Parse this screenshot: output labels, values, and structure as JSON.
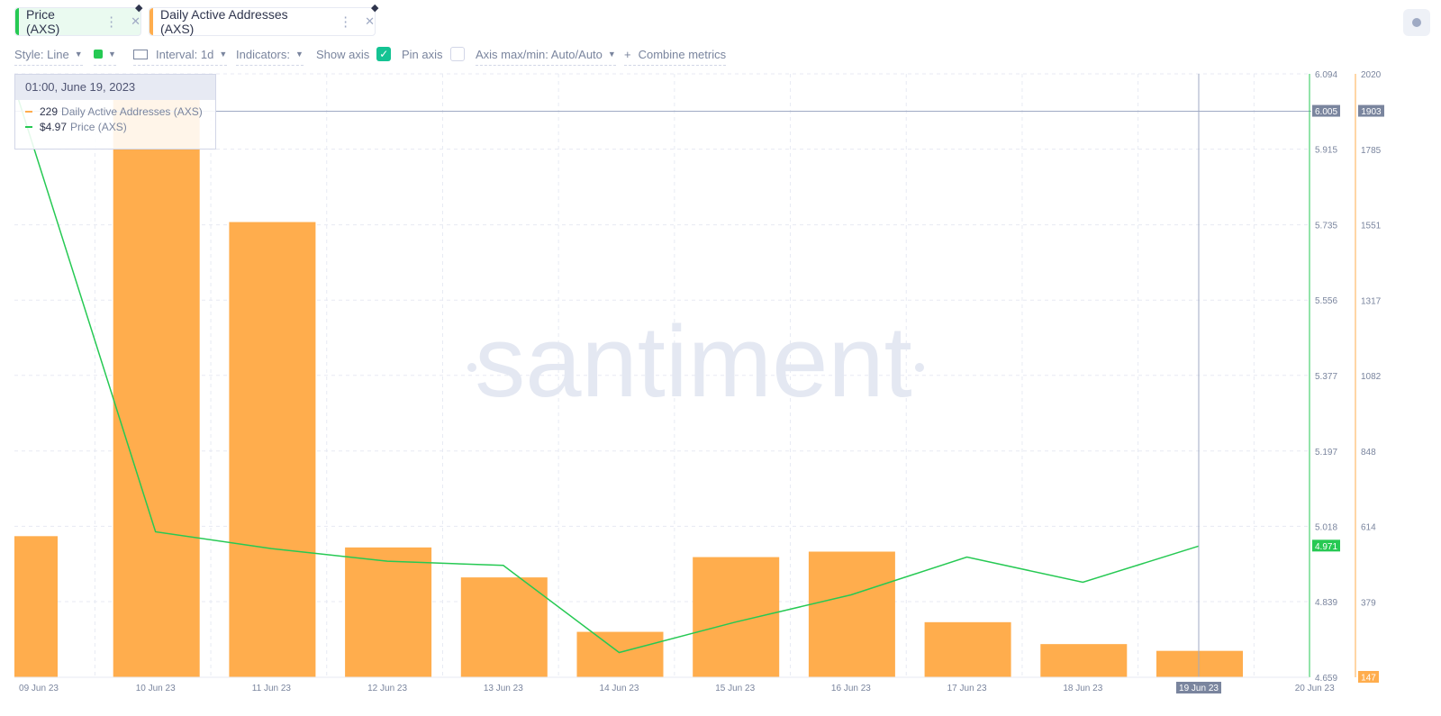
{
  "tabs": [
    {
      "label": "Price (AXS)",
      "color": "#26c953",
      "active": true
    },
    {
      "label": "Daily Active Addresses (AXS)",
      "color": "#ffad4d",
      "active": false
    }
  ],
  "toolbar": {
    "style_label": "Style: Line",
    "interval_label": "Interval: 1d",
    "indicators_label": "Indicators:",
    "show_axis_label": "Show axis",
    "show_axis_checked": true,
    "pin_axis_label": "Pin axis",
    "pin_axis_checked": false,
    "axis_maxmin_label": "Axis max/min: Auto/Auto",
    "combine_label": "Combine metrics",
    "metric_color": "#26c953"
  },
  "tooltip": {
    "date": "01:00, June 19, 2023",
    "rows": [
      {
        "value": "229",
        "name": "Daily Active Addresses (AXS)",
        "color": "#ffad4d"
      },
      {
        "value": "$4.97",
        "name": "Price (AXS)",
        "color": "#26c953"
      }
    ]
  },
  "watermark": "santiment",
  "chart_data": {
    "type": "bar",
    "categories": [
      "09 Jun 23",
      "10 Jun 23",
      "11 Jun 23",
      "12 Jun 23",
      "13 Jun 23",
      "14 Jun 23",
      "15 Jun 23",
      "16 Jun 23",
      "17 Jun 23",
      "18 Jun 23",
      "19 Jun 23",
      "20 Jun 23"
    ],
    "series": [
      {
        "name": "Daily Active Addresses (AXS)",
        "type": "bar",
        "color": "#ffad4d",
        "axis": "right",
        "values": [
          585,
          2020,
          1560,
          550,
          457,
          288,
          520,
          537,
          318,
          250,
          229,
          null
        ]
      },
      {
        "name": "Price (AXS)",
        "type": "line",
        "color": "#26c953",
        "axis": "left",
        "values": [
          6.05,
          5.005,
          4.965,
          4.935,
          4.925,
          4.718,
          4.79,
          4.855,
          4.945,
          4.885,
          4.971,
          null
        ]
      }
    ],
    "price_axis": {
      "ticks": [
        "6.094",
        "5.915",
        "5.735",
        "5.556",
        "5.377",
        "5.197",
        "5.018",
        "4.839",
        "4.659"
      ],
      "ylim": [
        4.659,
        6.094
      ]
    },
    "dau_axis": {
      "ticks": [
        "2020",
        "1785",
        "1551",
        "1317",
        "1082",
        "848",
        "614",
        "379",
        "147"
      ],
      "ylim": [
        147,
        2020
      ]
    },
    "crosshair": {
      "category": "19 Jun 23",
      "price_marker": "6.005",
      "dau_marker": "1903"
    },
    "last_price_label": "4.971",
    "min_dau_label": "147"
  }
}
